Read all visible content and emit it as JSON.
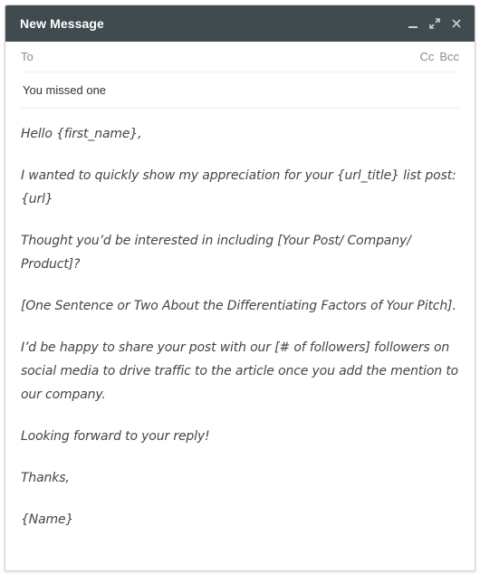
{
  "window": {
    "title": "New Message",
    "controls": [
      "minimize-icon",
      "expand-icon",
      "close-icon"
    ]
  },
  "recipients": {
    "to_label": "To",
    "cc_label": "Cc",
    "bcc_label": "Bcc"
  },
  "subject": {
    "value": "You missed one"
  },
  "body": {
    "paragraphs": [
      "Hello {first_name},",
      "I wanted to quickly show my appreciation for your {url_title} list post: {url}",
      "Thought you’d be interested in including [Your Post/ Company/ Product]?",
      "[One Sentence or Two About the Differentiating Factors of Your Pitch].",
      "I’d be happy to share your post with our [# of followers] followers on social media to drive traffic to the article once you add the mention to our company.",
      "Looking forward to your reply!",
      "Thanks,",
      "{Name}"
    ]
  },
  "colors": {
    "header_bg": "#404b4f",
    "header_text": "#ffffff",
    "body_text": "#454545",
    "muted_text": "#8a8a8a"
  }
}
